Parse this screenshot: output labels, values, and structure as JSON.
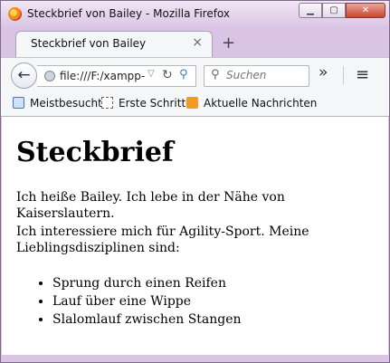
{
  "window": {
    "title": "Steckbrief von Bailey - Mozilla Firefox",
    "minimize": "▁",
    "maximize": "▢",
    "close": "✕"
  },
  "tab": {
    "label": "Steckbrief von Bailey",
    "close": "×",
    "new_tab": "+"
  },
  "navbar": {
    "back": "←",
    "url": "file:///F:/xampp-",
    "url_dropdown": "▽",
    "reload": "↻",
    "search_go": "⚲",
    "search_placeholder": "Suchen",
    "overflow": "»",
    "menu": "≡"
  },
  "bookmarks": [
    {
      "label": "Meistbesucht",
      "icon": "most-visited-icon"
    },
    {
      "label": "Erste Schritte",
      "icon": "page-icon"
    },
    {
      "label": "Aktuelle Nachrichten",
      "icon": "rss-icon"
    }
  ],
  "page": {
    "heading": "Steckbrief",
    "intro": "Ich heiße Bailey. Ich lebe in der Nähe von Kaiserslautern.",
    "interests": "Ich interessiere mich für Agility-Sport. Meine Lieblingsdisziplinen sind:",
    "disciplines": [
      "Sprung durch einen Reifen",
      "Lauf über eine Wippe",
      "Slalomlauf zwischen Stangen"
    ]
  }
}
